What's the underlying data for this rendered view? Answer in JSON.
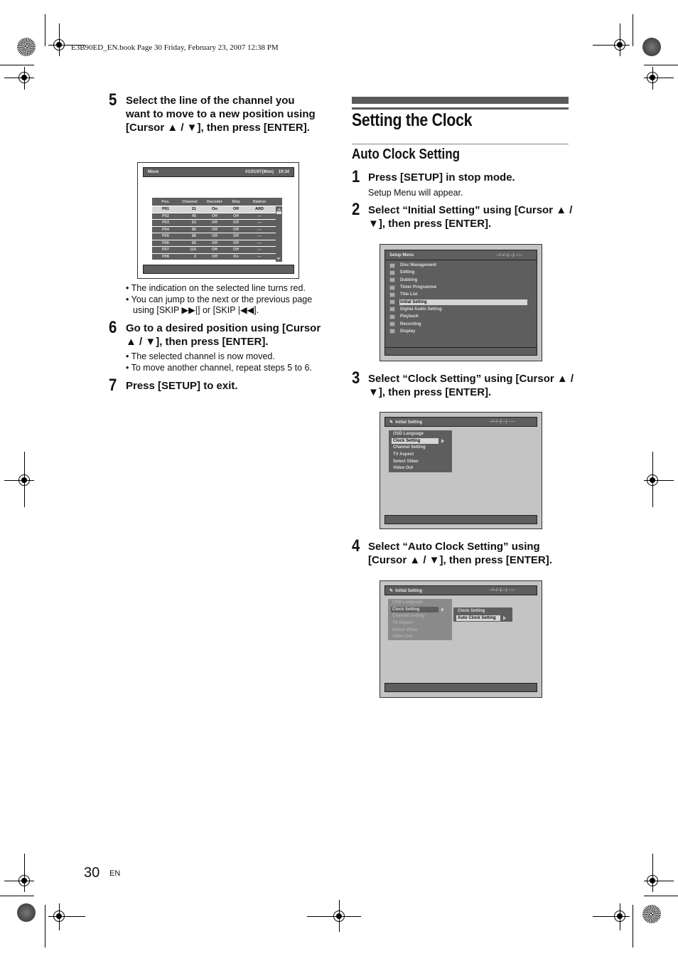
{
  "header": {
    "book_info": "E3B90ED_EN.book  Page 30  Friday, February 23, 2007  12:38 PM"
  },
  "left": {
    "step5": {
      "num": "5",
      "text": "Select the line of the channel you want to move to a new position using [Cursor ▲ / ▼], then press [ENTER]."
    },
    "move_screen": {
      "title": "Move",
      "date": "01/01/07(Mon)",
      "time": "19:34",
      "columns": [
        "Pos.",
        "Channel",
        "Decoder",
        "Skip",
        "Station"
      ],
      "rows": [
        [
          "P01",
          "21",
          "On",
          "Off",
          "ARD"
        ],
        [
          "P02",
          "45",
          "Off",
          "Off",
          "---"
        ],
        [
          "P03",
          "63",
          "Off",
          "Off",
          "---"
        ],
        [
          "P04",
          "80",
          "Off",
          "Off",
          "---"
        ],
        [
          "P05",
          "88",
          "Off",
          "Off",
          "---"
        ],
        [
          "P06",
          "95",
          "Off",
          "Off",
          "---"
        ],
        [
          "P07",
          "110",
          "Off",
          "Off",
          "---"
        ],
        [
          "P08",
          "2",
          "Off",
          "On",
          "---"
        ]
      ],
      "selected_row": 0
    },
    "step5_bullets": [
      "• The indication on the selected line turns red.",
      "• You can jump to the next or the previous page using [SKIP ▶▶|] or [SKIP |◀◀]."
    ],
    "step6": {
      "num": "6",
      "text": "Go to a desired position using [Cursor ▲ / ▼], then press [ENTER]."
    },
    "step6_bullets": [
      "• The selected channel is now moved.",
      "• To move another channel, repeat steps 5 to 6."
    ],
    "step7": {
      "num": "7",
      "text": "Press [SETUP] to exit."
    }
  },
  "right": {
    "title": "Setting the Clock",
    "subtitle": "Auto Clock Setting",
    "step1": {
      "num": "1",
      "text": "Press [SETUP] in stop mode.",
      "sub": "Setup Menu will appear."
    },
    "step2": {
      "num": "2",
      "text": "Select “Initial Setting” using [Cursor ▲ / ▼], then press [ENTER]."
    },
    "setup_screen": {
      "title": "Setup Menu",
      "datetime": "--/--/--(---)   --:--",
      "items": [
        "Disc Management",
        "Editing",
        "Dubbing",
        "Timer Programme",
        "Title List",
        "Initial Setting",
        "Digital Audio Setting",
        "Playback",
        "Recording",
        "Display"
      ],
      "icons": [
        "disc-icon",
        "editing-icon",
        "dubbing-icon",
        "timer-icon",
        "title-list-icon",
        "initial-setting-icon",
        "digital-audio-icon",
        "playback-icon",
        "recording-icon",
        "display-icon"
      ],
      "selected": 5
    },
    "step3": {
      "num": "3",
      "text": "Select “Clock Setting” using [Cursor ▲ / ▼], then press [ENTER]."
    },
    "initial_screen": {
      "title": "Initial Setting",
      "datetime": "--/--/--(---)   --:--",
      "items": [
        "OSD Language",
        "Clock Setting",
        "Channel Setting",
        "TV Aspect",
        "Select Video",
        "Video Out"
      ],
      "selected": 1
    },
    "step4": {
      "num": "4",
      "text": "Select “Auto Clock Setting” using [Cursor ▲ / ▼], then press [ENTER]."
    },
    "clock_screen": {
      "title": "Initial Setting",
      "datetime": "--/--/--(---)   --:--",
      "items": [
        "OSD Language",
        "Clock Setting",
        "Channel Setting",
        "TV Aspect",
        "Select Video",
        "Video Out"
      ],
      "selected": 1,
      "submenu": [
        "Clock Setting",
        "Auto Clock Setting"
      ],
      "submenu_selected": 1
    }
  },
  "footer": {
    "page_number": "30",
    "lang": "EN"
  }
}
